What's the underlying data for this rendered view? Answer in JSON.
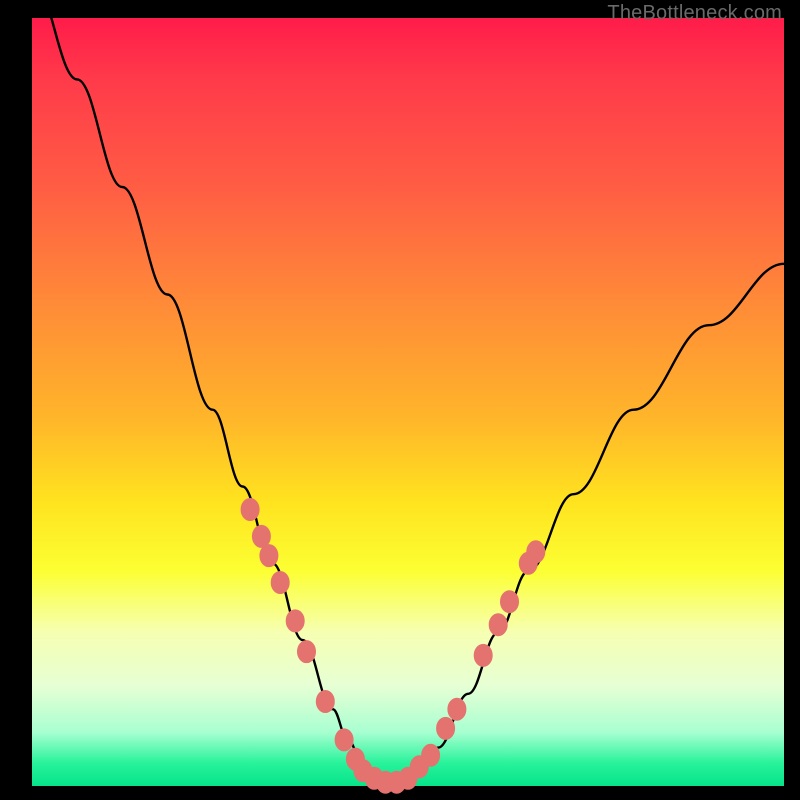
{
  "watermark": "TheBottleneck.com",
  "chart_data": {
    "type": "line",
    "title": "",
    "xlabel": "",
    "ylabel": "",
    "xlim": [
      0,
      100
    ],
    "ylim": [
      0,
      100
    ],
    "grid": false,
    "series": [
      {
        "name": "bottleneck-curve",
        "x": [
          0,
          6,
          12,
          18,
          24,
          28,
          32,
          36,
          40,
          42,
          44,
          46,
          48,
          50,
          54,
          58,
          62,
          66,
          72,
          80,
          90,
          100
        ],
        "values": [
          105,
          92,
          78,
          64,
          49,
          39,
          29,
          19,
          10,
          6,
          3,
          1,
          0,
          1,
          5,
          12,
          20,
          28,
          38,
          49,
          60,
          68
        ]
      }
    ],
    "markers": {
      "name": "beads",
      "color": "#e4736f",
      "points": [
        {
          "x": 29.0,
          "y": 36.0
        },
        {
          "x": 30.5,
          "y": 32.5
        },
        {
          "x": 31.5,
          "y": 30.0
        },
        {
          "x": 33.0,
          "y": 26.5
        },
        {
          "x": 35.0,
          "y": 21.5
        },
        {
          "x": 36.5,
          "y": 17.5
        },
        {
          "x": 39.0,
          "y": 11.0
        },
        {
          "x": 41.5,
          "y": 6.0
        },
        {
          "x": 43.0,
          "y": 3.5
        },
        {
          "x": 44.0,
          "y": 2.0
        },
        {
          "x": 45.5,
          "y": 1.0
        },
        {
          "x": 47.0,
          "y": 0.5
        },
        {
          "x": 48.5,
          "y": 0.5
        },
        {
          "x": 50.0,
          "y": 1.0
        },
        {
          "x": 51.5,
          "y": 2.5
        },
        {
          "x": 53.0,
          "y": 4.0
        },
        {
          "x": 55.0,
          "y": 7.5
        },
        {
          "x": 56.5,
          "y": 10.0
        },
        {
          "x": 60.0,
          "y": 17.0
        },
        {
          "x": 62.0,
          "y": 21.0
        },
        {
          "x": 63.5,
          "y": 24.0
        },
        {
          "x": 66.0,
          "y": 29.0
        },
        {
          "x": 67.0,
          "y": 30.5
        }
      ]
    }
  }
}
